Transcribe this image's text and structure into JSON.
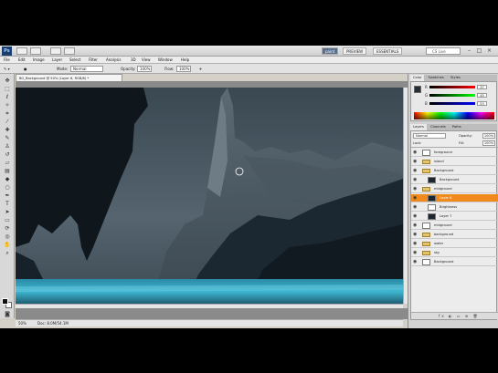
{
  "app": {
    "logo": "Ps",
    "workspaces": [
      "paint",
      "PREVIEW",
      "ESSENTIALS"
    ],
    "active_workspace": "paint",
    "search_placeholder": "CS Live"
  },
  "menu": [
    "File",
    "Edit",
    "Image",
    "Layer",
    "Select",
    "Filter",
    "Analysis",
    "3D",
    "View",
    "Window",
    "Help"
  ],
  "options_bar": {
    "mode_label": "Mode:",
    "mode_value": "Normal",
    "opacity_label": "Opacity:",
    "opacity_value": "100%",
    "flow_label": "Flow:",
    "flow_value": "100%"
  },
  "document": {
    "tab_title": "BG_Background @ 50% (Layer 6, RGB/8) *",
    "zoom": "50%",
    "doc_info": "Doc: 8.0M/54.1M"
  },
  "color_panel": {
    "tabs": [
      "Color",
      "Swatches",
      "Styles"
    ],
    "sliders": [
      {
        "label": "R",
        "value": "37"
      },
      {
        "label": "G",
        "value": "45"
      },
      {
        "label": "B",
        "value": "53"
      }
    ]
  },
  "layers_panel": {
    "tabs": [
      "Layers",
      "Channels",
      "Paths"
    ],
    "blend_mode": "Normal",
    "opacity_label": "Opacity:",
    "opacity_value": "100%",
    "lock_label": "Lock:",
    "fill_label": "Fill:",
    "fill_value": "100%",
    "layers": [
      {
        "name": "foreground",
        "indent": 0,
        "kind": "layer",
        "selected": false
      },
      {
        "name": "island",
        "indent": 0,
        "kind": "folder",
        "selected": false
      },
      {
        "name": "Background",
        "indent": 0,
        "kind": "folder",
        "selected": false
      },
      {
        "name": "Background",
        "indent": 1,
        "kind": "layer",
        "selected": false
      },
      {
        "name": "midground",
        "indent": 0,
        "kind": "folder",
        "selected": false
      },
      {
        "name": "Layer 6",
        "indent": 1,
        "kind": "layer",
        "selected": true
      },
      {
        "name": "Brightness",
        "indent": 1,
        "kind": "adjustment",
        "selected": false
      },
      {
        "name": "Layer 7",
        "indent": 1,
        "kind": "layer",
        "selected": false
      },
      {
        "name": "midground",
        "indent": 0,
        "kind": "layer",
        "selected": false
      },
      {
        "name": "background",
        "indent": 0,
        "kind": "folder",
        "selected": false
      },
      {
        "name": "water",
        "indent": 0,
        "kind": "folder",
        "selected": false
      },
      {
        "name": "sky",
        "indent": 0,
        "kind": "folder",
        "selected": false
      },
      {
        "name": "Background",
        "indent": 0,
        "kind": "layer",
        "selected": false
      }
    ],
    "footer_icons": "fx ◐ ▭ ⊕ 🗑"
  },
  "colors": {
    "accent_selected": "#f08a1d",
    "canvas_dark": "#141c22",
    "water": "#3fb6d1"
  }
}
